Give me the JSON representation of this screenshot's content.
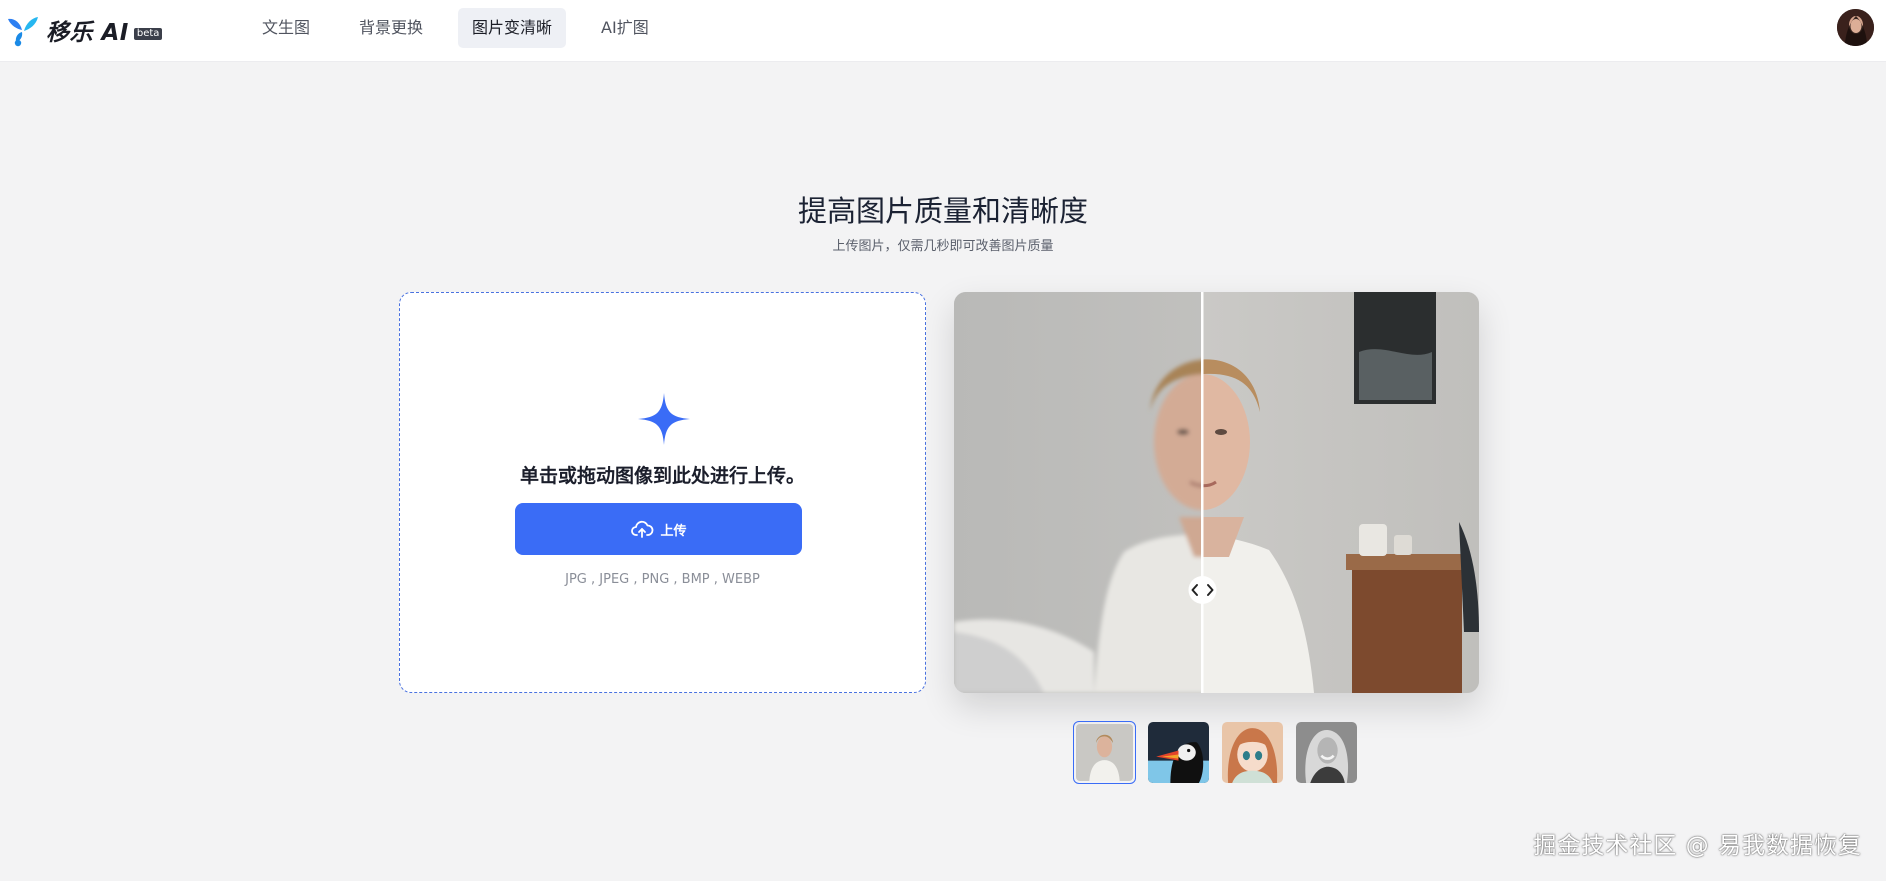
{
  "header": {
    "logo_text": "移乐 AI",
    "logo_badge": "beta",
    "nav": [
      {
        "label": "文生图",
        "active": false
      },
      {
        "label": "背景更换",
        "active": false
      },
      {
        "label": "图片变清晰",
        "active": true
      },
      {
        "label": "AI扩图",
        "active": false
      }
    ],
    "avatar_icon": "user-avatar",
    "accent_color": "#3a6cf6"
  },
  "hero": {
    "title": "提高图片质量和清晰度",
    "subtitle": "上传图片，仅需几秒即可改善图片质量"
  },
  "upload": {
    "hint": "单击或拖动图像到此处进行上传。",
    "button_label": "上传",
    "button_icon": "cloud-upload-icon",
    "formats": "JPG , JPEG , PNG , BMP , WEBP"
  },
  "preview": {
    "slider_icon": "chevron-left-right-icon",
    "thumbnails": [
      {
        "name": "young-man-portrait",
        "selected": true
      },
      {
        "name": "puffin-bird",
        "selected": false
      },
      {
        "name": "anime-girl",
        "selected": false
      },
      {
        "name": "smiling-woman-bw",
        "selected": false
      }
    ]
  },
  "watermark": "掘金技术社区 @ 易我数据恢复"
}
